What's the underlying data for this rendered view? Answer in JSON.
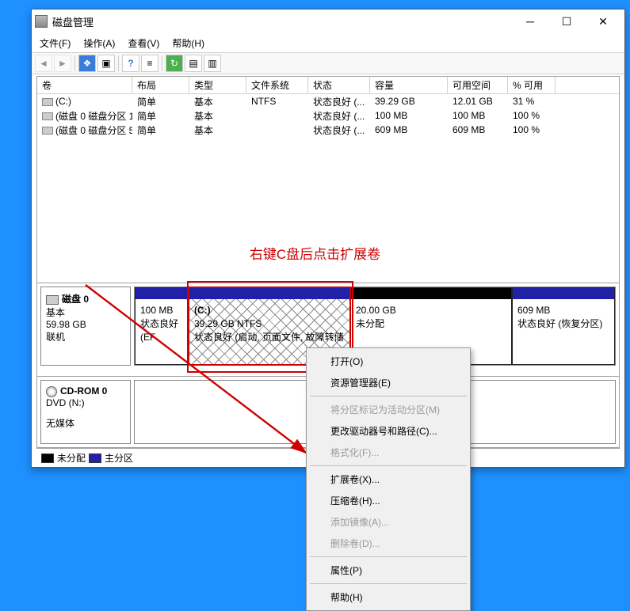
{
  "window": {
    "title": "磁盘管理"
  },
  "menubar": {
    "file": "文件(F)",
    "action": "操作(A)",
    "view": "查看(V)",
    "help": "帮助(H)"
  },
  "columns": {
    "volume": "卷",
    "layout": "布局",
    "type": "类型",
    "filesystem": "文件系统",
    "status": "状态",
    "capacity": "容量",
    "free": "可用空间",
    "pct": "% 可用"
  },
  "volumes": [
    {
      "name": "(C:)",
      "layout": "简单",
      "type": "基本",
      "fs": "NTFS",
      "status": "状态良好 (...",
      "cap": "39.29 GB",
      "free": "12.01 GB",
      "pct": "31 %"
    },
    {
      "name": "(磁盘 0 磁盘分区 1)",
      "layout": "简单",
      "type": "基本",
      "fs": "",
      "status": "状态良好 (...",
      "cap": "100 MB",
      "free": "100 MB",
      "pct": "100 %"
    },
    {
      "name": "(磁盘 0 磁盘分区 5)",
      "layout": "简单",
      "type": "基本",
      "fs": "",
      "status": "状态良好 (...",
      "cap": "609 MB",
      "free": "609 MB",
      "pct": "100 %"
    }
  ],
  "annotation": "右键C盘后点击扩展卷",
  "disk0": {
    "title": "磁盘 0",
    "type": "基本",
    "size": "59.98 GB",
    "state": "联机",
    "parts": [
      {
        "label": "",
        "size": "100 MB",
        "status": "状态良好 (EF"
      },
      {
        "label": "(C:)",
        "size": "39.29 GB NTFS",
        "status": "状态良好 (启动, 页面文件, 故障转储"
      },
      {
        "label": "",
        "size": "20.00 GB",
        "status": "未分配"
      },
      {
        "label": "",
        "size": "609 MB",
        "status": "状态良好 (恢复分区)"
      }
    ]
  },
  "cdrom": {
    "title": "CD-ROM 0",
    "line1": "DVD (N:)",
    "line2": "无媒体"
  },
  "legend": {
    "unalloc": "未分配",
    "primary": "主分区"
  },
  "context_menu": {
    "open": "打开(O)",
    "explorer": "资源管理器(E)",
    "mark_active": "将分区标记为活动分区(M)",
    "change_drive": "更改驱动器号和路径(C)...",
    "format": "格式化(F)...",
    "extend": "扩展卷(X)...",
    "shrink": "压缩卷(H)...",
    "add_mirror": "添加镜像(A)...",
    "delete_vol": "删除卷(D)...",
    "properties": "属性(P)",
    "help": "帮助(H)"
  }
}
